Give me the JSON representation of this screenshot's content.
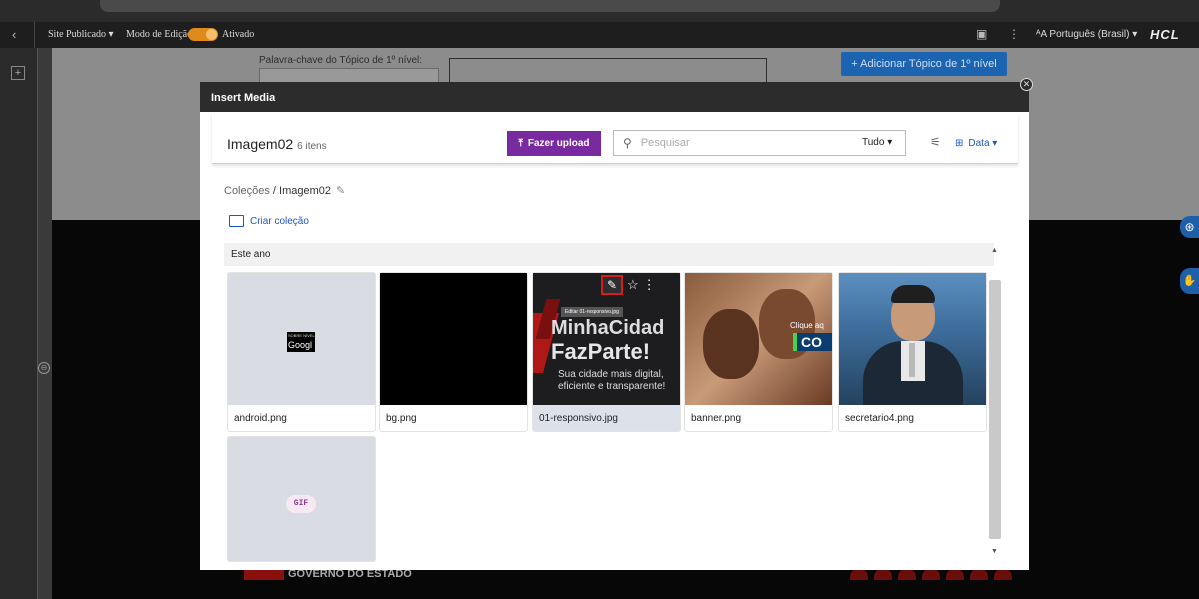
{
  "toolbar": {
    "back": "‹",
    "site_status": "Site Publicado ▾",
    "edit_mode_label": "Modo de Edição:",
    "edit_mode_state": "Ativado",
    "calendar_icon": "▣",
    "more_icon": "⋮",
    "language": "ᴬA Português (Brasil) ▾",
    "brand": "HCL"
  },
  "rail": {
    "add": "+",
    "collapse": "⊖"
  },
  "background": {
    "field_label": "Palavra-chave do Tópico de 1º nível:",
    "add_topic_button": "+ Adicionar Tópico de 1º nível",
    "footer_logo": "GOVERNO DO ESTADO",
    "accessibility_icon": "⊛",
    "libras_icon": "✋"
  },
  "modal": {
    "title": "Insert Media",
    "close": "✕",
    "collection_name": "Imagem02",
    "item_count": "6 itens",
    "upload_button": "Fazer upload",
    "upload_icon": "⤒",
    "search_icon": "⚲",
    "search_placeholder": "Pesquisar",
    "filter": "Tudo ▾",
    "tune_icon": "⚟",
    "sort_grid_icon": "⊞",
    "sort": "Data ▾",
    "breadcrumb_root": "Coleções",
    "breadcrumb_sep": " / ",
    "breadcrumb_current": "Imagem02",
    "breadcrumb_edit_icon": "✎",
    "create_collection": "Criar coleção",
    "group_header": "Este ano",
    "scroll_up": "▲",
    "scroll_down": "▼"
  },
  "media": [
    {
      "name": "android.png",
      "thumb_text_small": "SOBRE NÍVEL",
      "thumb_text": "Googl"
    },
    {
      "name": "bg.png"
    },
    {
      "name": "01-responsivo.jpg",
      "tooltip": "Editar 01-responsivo.jpg",
      "headline1": "MinhaCidad",
      "headline2": "FazParte!",
      "tagline1": "Sua cidade mais digital,",
      "tagline2": "eficiente e transparente!",
      "edit_icon": "✎",
      "star_icon": "☆",
      "more_icon": "⋮"
    },
    {
      "name": "banner.png",
      "cta_small": "Clique aq",
      "cta_big": "CO"
    },
    {
      "name": "secretario4.png"
    },
    {
      "name": "",
      "badge": "GIF"
    }
  ],
  "colors": {
    "upload_purple": "#7a2aa0",
    "link_blue": "#1c58c4",
    "highlight_red": "#d21e1e",
    "toggle_orange": "#e08a1e"
  }
}
